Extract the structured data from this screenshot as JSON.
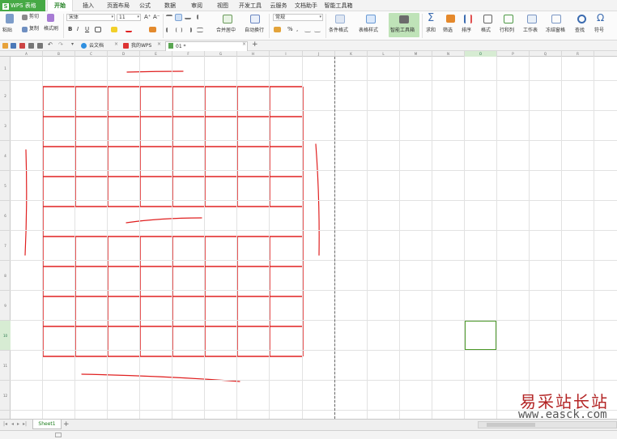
{
  "app_menu": {
    "label": "WPS 表格",
    "logo": "S"
  },
  "menu_tabs": [
    "开始",
    "插入",
    "页面布局",
    "公式",
    "数据",
    "审阅",
    "视图",
    "开发工具",
    "云服务",
    "文档助手",
    "智能工具箱"
  ],
  "active_menu_tab": "开始",
  "ribbon": {
    "cut": "剪切",
    "copy": "复制",
    "format_painter": "格式刷",
    "paste": "粘贴",
    "font_name": "宋体",
    "font_size": "11",
    "font_grow": "A⁺",
    "font_shrink": "A⁻",
    "bold": "B",
    "italic": "I",
    "underline": "U",
    "merge_center": "合并居中",
    "wrap_text": "自动换行",
    "number_format": "常规",
    "percent": "%",
    "comma": ",",
    "conditional_format": "条件格式",
    "table_style": "表格样式",
    "smart_toolbox": "智能工具箱",
    "sum": "求和",
    "filter": "筛选",
    "sort": "排序",
    "format": "格式",
    "rows_cols": "行和列",
    "worksheet": "工作表",
    "freeze": "冻结窗格",
    "find": "查找",
    "symbol": "符号"
  },
  "doc_tabs": [
    {
      "label": "云文档"
    },
    {
      "label": "我的WPS"
    },
    {
      "label": "01 *"
    }
  ],
  "columns": [
    "A",
    "B",
    "C",
    "D",
    "E",
    "F",
    "G",
    "H",
    "I",
    "J",
    "K",
    "L",
    "M",
    "N",
    "O",
    "P",
    "Q",
    "R"
  ],
  "rows": [
    "1",
    "2",
    "3",
    "4",
    "5",
    "6",
    "7",
    "8",
    "9",
    "10",
    "11",
    "12"
  ],
  "selected_cell": {
    "column": "O",
    "row": "10"
  },
  "sheet_tabs": [
    "Sheet1"
  ],
  "add_sheet": "+",
  "colors": {
    "brand": "#46a945",
    "grid_border": "#e02020",
    "selection": "#4d9a2a"
  },
  "watermark": {
    "chinese": "易采站长站",
    "url": "www.easck.com"
  }
}
